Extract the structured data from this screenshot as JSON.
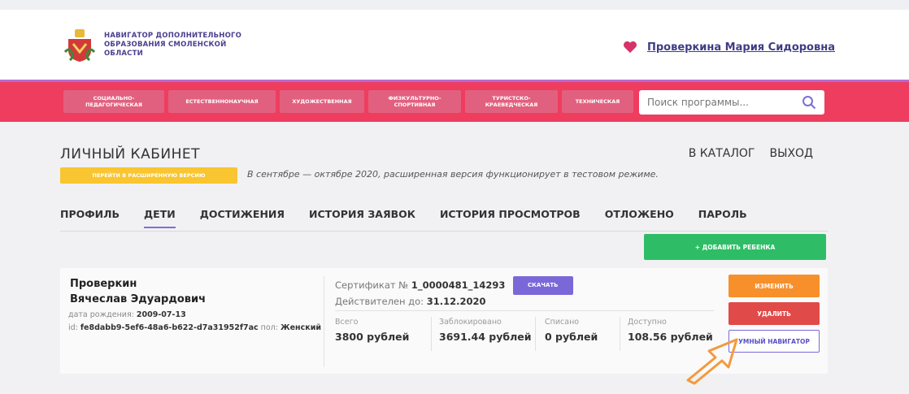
{
  "header": {
    "site_name": "НАВИГАТОР ДОПОЛНИТЕЛЬНОГО ОБРАЗОВАНИЯ СМОЛЕНСКОЙ ОБЛАСТИ",
    "user_name": "Проверкина Мария Сидоровна",
    "logo_icon": "coat-of-arms-icon",
    "favorites_icon": "heart-icon"
  },
  "categories": [
    "СОЦИАЛЬНО-ПЕДАГОГИЧЕСКАЯ",
    "ЕСТЕСТВЕННОНАУЧНАЯ",
    "ХУДОЖЕСТВЕННАЯ",
    "ФИЗКУЛЬТУРНО-СПОРТИВНАЯ",
    "ТУРИСТСКО-КРАЕВЕДЧЕСКАЯ",
    "ТЕХНИЧЕСКАЯ"
  ],
  "search": {
    "placeholder": "Поиск программы..."
  },
  "page": {
    "title": "ЛИЧНЫЙ КАБИНЕТ",
    "catalog_link": "В КАТАЛОГ",
    "logout_link": "ВЫХОД",
    "extended_button": "ПЕРЕЙТИ В РАСШИРЕННУЮ ВЕРСИЮ",
    "notice": "В сентябре — октябре 2020, расширенная версия функционирует в тестовом режиме."
  },
  "tabs": [
    "ПРОФИЛЬ",
    "ДЕТИ",
    "ДОСТИЖЕНИЯ",
    "ИСТОРИЯ ЗАЯВОК",
    "ИСТОРИЯ ПРОСМОТРОВ",
    "ОТЛОЖЕНО",
    "ПАРОЛЬ"
  ],
  "active_tab": "ДЕТИ",
  "add_child_button": "+ ДОБАВИТЬ РЕБЕНКА",
  "child": {
    "last_name": "Проверкин",
    "first_names": "Вячеслав Эдуардович",
    "birth_label": "дата рождения:",
    "birth_date": "2009-07-13",
    "id_label": "id:",
    "id_value": "fe8dabb9-5ef6-48a6-b622-d7a31952f7ac",
    "gender_label": "пол:",
    "gender_value": "Женский",
    "certificate_label": "Сертификат №",
    "certificate_number": "1_0000481_14293",
    "download_button": "СКАЧАТЬ",
    "valid_label": "Действителен до:",
    "valid_until": "31.12.2020",
    "balances": [
      {
        "label": "Всего",
        "value": "3800 рублей"
      },
      {
        "label": "Заблокировано",
        "value": "3691.44 рублей"
      },
      {
        "label": "Списано",
        "value": "0 рублей"
      },
      {
        "label": "Доступно",
        "value": "108.56 рублей"
      }
    ],
    "actions": {
      "edit": "ИЗМЕНИТЬ",
      "delete": "УДАЛИТЬ",
      "navigator": "УМНЫЙ НАВИГАТОР"
    }
  },
  "colors": {
    "accent_band": "#ee3d5e",
    "add_button": "#2ebd66",
    "edit_button": "#f78f2a",
    "delete_button": "#e04a48",
    "highlight": "#f9c530",
    "arrow": "#f39a3c"
  }
}
